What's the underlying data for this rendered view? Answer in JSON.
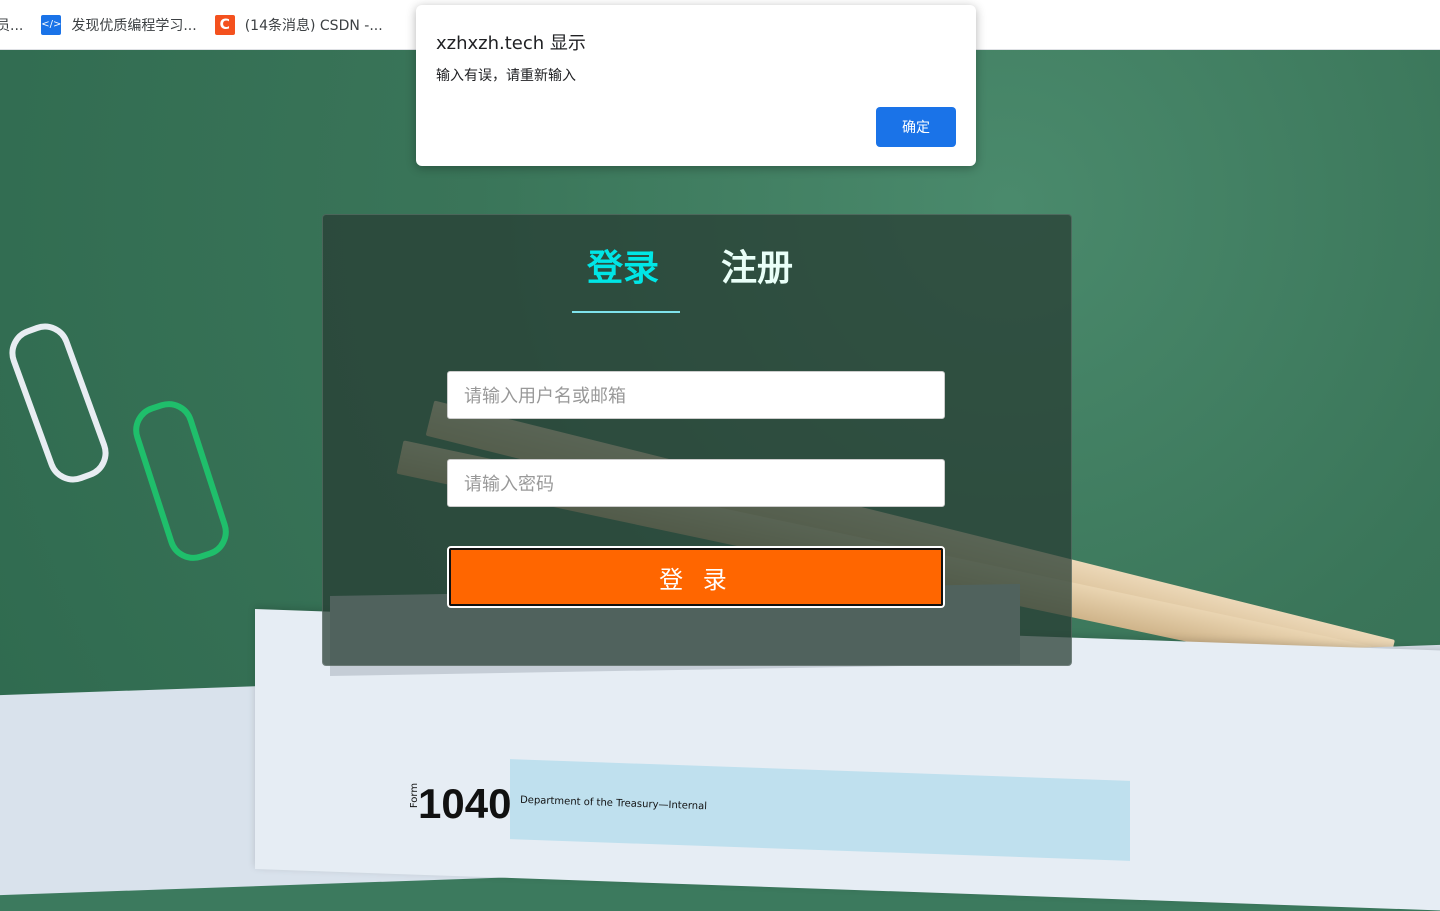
{
  "bookmarks": [
    {
      "label": "员...",
      "icon": "bookmark-icon"
    },
    {
      "label": "发现优质编程学习...",
      "icon": "code-icon"
    },
    {
      "label": "(14条消息) CSDN -...",
      "icon": "csdn-icon",
      "icon_text": "C"
    }
  ],
  "dialog": {
    "title": "xzhxzh.tech 显示",
    "message": "输入有误，请重新输入",
    "ok_label": "确定"
  },
  "card": {
    "tabs": [
      {
        "label": "登录",
        "active": true
      },
      {
        "label": "注册",
        "active": false
      }
    ],
    "username_placeholder": "请输入用户名或邮箱",
    "password_placeholder": "请输入密码",
    "submit_label": "登 录"
  },
  "background": {
    "form_number": "1040",
    "form_label": "Form",
    "form_department": "Department of the Treasury—Internal"
  },
  "colors": {
    "active_tab": "#00e6e6",
    "submit_button": "#ff6600",
    "dialog_button": "#1a73e8"
  }
}
